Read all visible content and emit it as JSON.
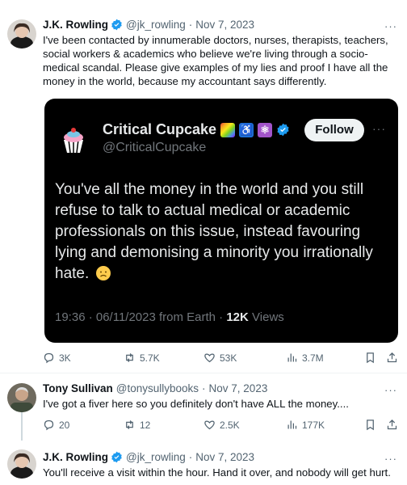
{
  "tweets": [
    {
      "name": "J.K. Rowling",
      "handle": "@jk_rowling",
      "date": "Nov 7, 2023",
      "text": "I've been contacted by innumerable doctors, nurses, therapists, teachers, social workers & academics who believe we're living through a socio-medical scandal. Please give examples of my lies and proof I have all the money in the world, because my accountant says differently.",
      "replies": "3K",
      "reposts": "5.7K",
      "likes": "53K",
      "views": "3.7M"
    },
    {
      "name": "Tony Sullivan",
      "handle": "@tonysullybooks",
      "date": "Nov 7, 2023",
      "text": "I've got a fiver here so you definitely don't have ALL the money....",
      "replies": "20",
      "reposts": "12",
      "likes": "2.5K",
      "views": "177K"
    },
    {
      "name": "J.K. Rowling",
      "handle": "@jk_rowling",
      "date": "Nov 7, 2023",
      "text": "You'll receive a visit within the hour. Hand it over, and nobody will get hurt."
    }
  ],
  "embedded": {
    "name": "Critical Cupcake",
    "handle": "@CriticalCupcake",
    "follow_label": "Follow",
    "text": "You've all the money in the world and you still refuse to talk to actual medical or academic professionals on this issue, instead favouring lying and demonising a minority you irrationally hate.",
    "meta_prefix": "19:36 · 06/11/2023 from Earth · ",
    "views_count": "12K",
    "views_label": " Views"
  },
  "separator": "·",
  "more_glyph": "···",
  "icons": {
    "reply": "reply-icon",
    "repost": "repost-icon",
    "like": "like-icon",
    "views": "views-icon",
    "bookmark": "bookmark-icon",
    "share": "share-icon",
    "verified": "verified-badge-icon"
  },
  "colors": {
    "verified": "#1d9bf0",
    "secondary_text": "#536471",
    "card_background": "#000000"
  }
}
